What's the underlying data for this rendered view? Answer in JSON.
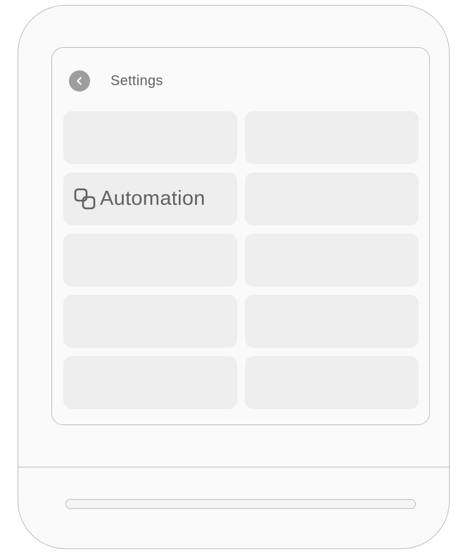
{
  "header": {
    "back_icon": "chevron-left-icon",
    "title": "Settings"
  },
  "tiles": [
    {
      "label": ""
    },
    {
      "label": ""
    },
    {
      "label": "Automation",
      "icon": "automation-icon"
    },
    {
      "label": ""
    },
    {
      "label": ""
    },
    {
      "label": ""
    },
    {
      "label": ""
    },
    {
      "label": ""
    },
    {
      "label": ""
    },
    {
      "label": ""
    }
  ],
  "colors": {
    "frame_border": "#bdbdbd",
    "tile_background": "#eeeeee",
    "text": "#616161",
    "back_button": "#9e9e9e"
  }
}
